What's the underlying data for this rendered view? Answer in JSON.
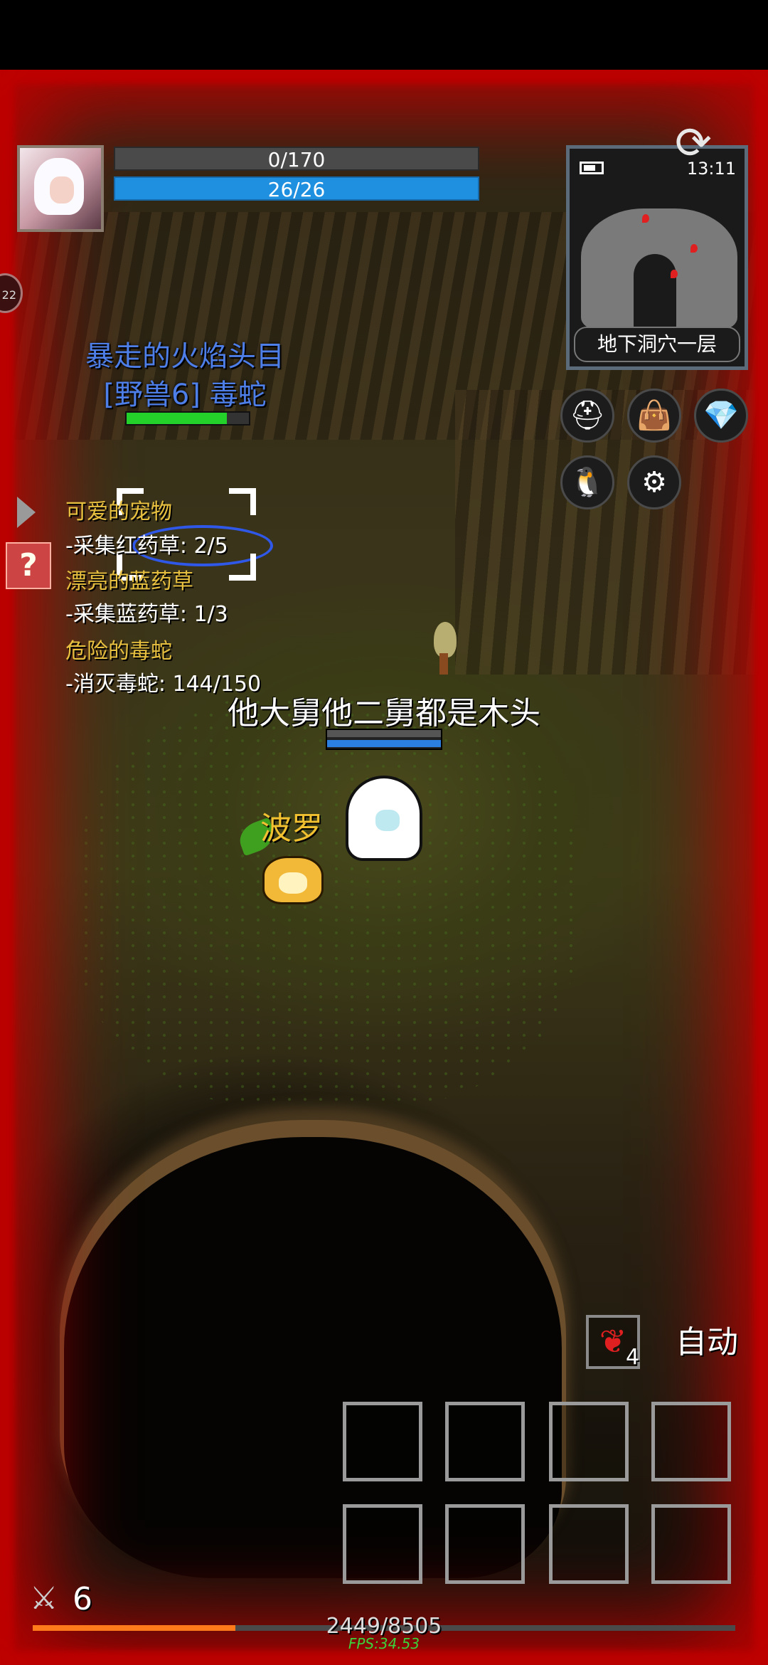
{
  "hud": {
    "hp_text": "0/170",
    "mp_text": "26/26",
    "hp_ratio": 0,
    "mp_ratio": 1
  },
  "minimap": {
    "time": "13:11",
    "floor_name": "地下洞穴一层"
  },
  "side_chip_label": "22",
  "quest_button": "?",
  "enemy": {
    "title": "暴走的火焰头目",
    "name": "[野兽6] 毒蛇",
    "hp_ratio": 0.82
  },
  "quests": [
    {
      "title": "可爱的宠物",
      "detail": "-采集红药草: 2/5"
    },
    {
      "title": "漂亮的蓝药草",
      "detail": "-采集蓝药草: 1/3"
    },
    {
      "title": "危险的毒蛇",
      "detail": "-消灭毒蛇: 144/150"
    }
  ],
  "player": {
    "name": "他大舅他二舅都是木头"
  },
  "pet": {
    "name": "波罗"
  },
  "item": {
    "count": "4",
    "icon": "red-herb-icon"
  },
  "auto_label": "自动",
  "level": "6",
  "exp": {
    "text": "2449/8505",
    "ratio": 0.288
  },
  "fps": "FPS:34.53",
  "colors": {
    "mp": "#1f8fe0",
    "enemy_name": "#4e7ee8",
    "quest_title": "#e8c040",
    "exp": "#ff7a1a",
    "fps": "#3cd23c",
    "vignette": "#b30000"
  }
}
